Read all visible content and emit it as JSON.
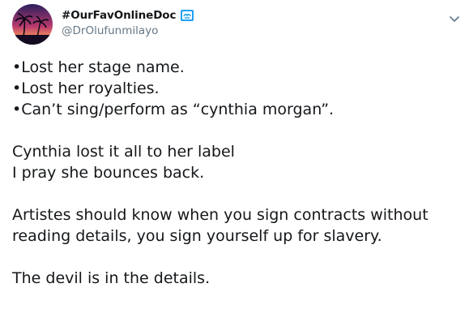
{
  "author": {
    "display_name": "#OurFavOnlineDoc",
    "handle": "@DrOlufunmilayo",
    "badge_icon": "verified-badge-icon",
    "caret_icon": "chevron-down-icon"
  },
  "colors": {
    "text": "#14171a",
    "secondary": "#657786",
    "badge": "#1da1f2"
  },
  "tweet": {
    "lines": [
      "•Lost her stage name.",
      "•Lost her royalties.",
      "•Can’t sing/perform as “cynthia morgan”.",
      "",
      "Cynthia lost it all to her label",
      "I pray she bounces back.",
      "",
      "Artistes should know when you sign contracts without",
      "reading details, you sign yourself up for slavery.",
      "",
      "The devil is in the details."
    ]
  }
}
